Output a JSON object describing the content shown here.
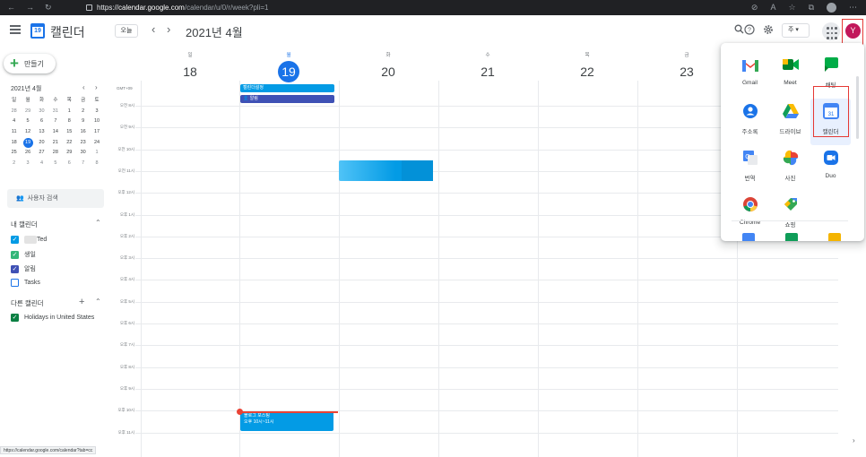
{
  "browser": {
    "nav": [
      "←",
      "→",
      "↻"
    ],
    "url_https": "https://",
    "url_host": "calendar.google.com",
    "url_path": "/calendar/u/0/r/week?pli=1"
  },
  "header": {
    "app_name": "캘린더",
    "logo_day": "19",
    "today_label": "오늘",
    "prev": "‹",
    "next": "›",
    "period": "2021년 4월",
    "view_select": "주",
    "avatar_letter": "Y"
  },
  "sidebar": {
    "create_label": "만들기",
    "mini_cal": {
      "title": "2021년 4월",
      "weekdays": [
        "일",
        "월",
        "화",
        "수",
        "목",
        "금",
        "토"
      ],
      "weeks": [
        [
          "28",
          "29",
          "30",
          "31",
          "1",
          "2",
          "3"
        ],
        [
          "4",
          "5",
          "6",
          "7",
          "8",
          "9",
          "10"
        ],
        [
          "11",
          "12",
          "13",
          "14",
          "15",
          "16",
          "17"
        ],
        [
          "18",
          "19",
          "20",
          "21",
          "22",
          "23",
          "24"
        ],
        [
          "25",
          "26",
          "27",
          "28",
          "29",
          "30",
          "1"
        ],
        [
          "2",
          "3",
          "4",
          "5",
          "6",
          "7",
          "8"
        ]
      ],
      "today": "19"
    },
    "people_search": "사용자 검색",
    "my_calendars_title": "내 캘린더",
    "my_calendars": [
      {
        "label": "Ted",
        "color": "#039be5",
        "checked": true
      },
      {
        "label": "생일",
        "color": "#33b679",
        "checked": true
      },
      {
        "label": "알림",
        "color": "#3f51b5",
        "checked": true
      },
      {
        "label": "Tasks",
        "color": "#1a73e8",
        "checked": false
      }
    ],
    "other_calendars_title": "다른 캘린더",
    "other_calendars": [
      {
        "label": "Holidays in United States",
        "color": "#0b8043",
        "checked": true
      }
    ]
  },
  "week": {
    "timezone": "GMT+09",
    "days": [
      {
        "dow": "일",
        "num": "18",
        "today": false
      },
      {
        "dow": "월",
        "num": "19",
        "today": true
      },
      {
        "dow": "화",
        "num": "20",
        "today": false
      },
      {
        "dow": "수",
        "num": "21",
        "today": false
      },
      {
        "dow": "목",
        "num": "22",
        "today": false
      },
      {
        "dow": "금",
        "num": "23",
        "today": false
      }
    ],
    "hours": [
      "오전 8시",
      "오전 9시",
      "오전 10시",
      "오전 11시",
      "오후 12시",
      "오후 1시",
      "오후 2시",
      "오후 3시",
      "오후 4시",
      "오후 5시",
      "오후 6시",
      "오후 7시",
      "오후 8시",
      "오후 9시",
      "오후 10시",
      "오후 11시"
    ],
    "allday_events": [
      {
        "label": "캘린더설정",
        "color": "#039be5"
      },
      {
        "label": "👤 알림",
        "color": "#3f51b5"
      }
    ],
    "event_bottom": {
      "title": "블로그 포스팅",
      "time": "오후 10시~11시"
    }
  },
  "apps_panel": {
    "apps": [
      {
        "name": "Gmail",
        "icon": "gmail-icon"
      },
      {
        "name": "Meet",
        "icon": "meet-icon"
      },
      {
        "name": "채팅",
        "icon": "chat-icon"
      },
      {
        "name": "주소록",
        "icon": "contacts-icon"
      },
      {
        "name": "드라이브",
        "icon": "drive-icon"
      },
      {
        "name": "캘린더",
        "icon": "calendar-icon"
      },
      {
        "name": "번역",
        "icon": "translate-icon"
      },
      {
        "name": "사진",
        "icon": "photos-icon"
      },
      {
        "name": "Duo",
        "icon": "duo-icon"
      },
      {
        "name": "Chrome",
        "icon": "chrome-icon"
      },
      {
        "name": "쇼핑",
        "icon": "shopping-icon"
      }
    ],
    "selected": "캘린더"
  },
  "status_bar": {
    "url": "https://calendar.google.com/calendar?tab=cc"
  }
}
